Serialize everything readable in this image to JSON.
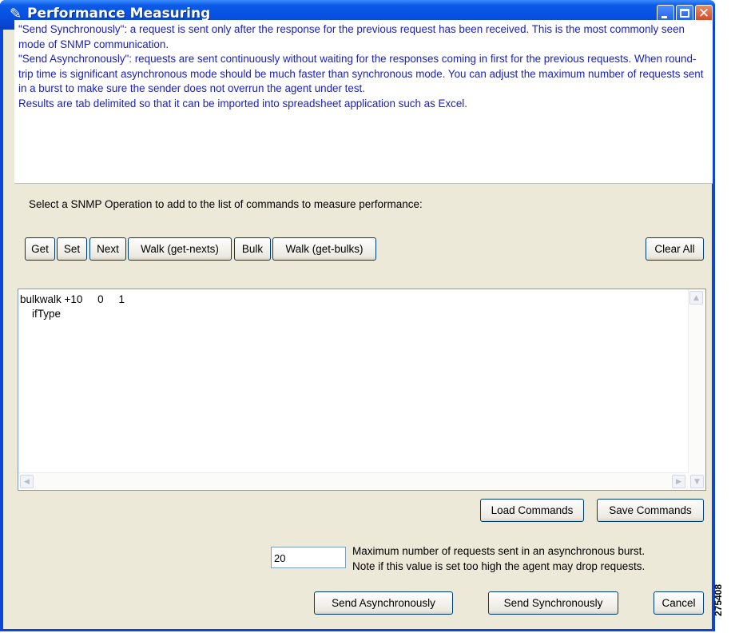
{
  "window": {
    "title": "Performance Measuring",
    "controls": [
      "minimize",
      "maximize",
      "close"
    ]
  },
  "info": {
    "paragraphs": [
      "\"Send Synchronously\": a request is sent only after the response for the previous request  has been received. This is the most commonly seen mode of SNMP communication.",
      "\"Send Asynchronously\": requests are sent continuously without waiting for the responses coming in first for the previous requests. When round-trip time is significant asynchronous mode should be much faster than synchronous mode. You can adjust the maximum number of requests sent in a burst to make sure the sender does not overrun the agent under test.",
      "Results are tab delimited so that it can be imported into spreadsheet application such as Excel."
    ]
  },
  "operations": {
    "label": "Select a SNMP Operation to add to the list of commands to measure performance:",
    "buttons": [
      "Get",
      "Set",
      "Next",
      "Walk (get-nexts)",
      "Bulk",
      "Walk (get-bulks)"
    ],
    "clear_all": "Clear All"
  },
  "commands": {
    "text": "bulkwalk +10     0     1\n    ifType"
  },
  "file_buttons": {
    "load": "Load Commands",
    "save": "Save Commands"
  },
  "burst": {
    "value": "20",
    "note_line1": "Maximum number of requests sent in an asynchronous burst.",
    "note_line2": "Note if this value is set too high the agent may drop requests."
  },
  "actions": {
    "send_async": "Send Asynchronously",
    "send_sync": "Send Synchronously",
    "cancel": "Cancel"
  },
  "figure_code": "275408",
  "colors": {
    "titlebar": "#0651e3",
    "dialog_bg": "#ece9d8",
    "info_text": "#1c22b8",
    "button_border": "#003c74"
  }
}
